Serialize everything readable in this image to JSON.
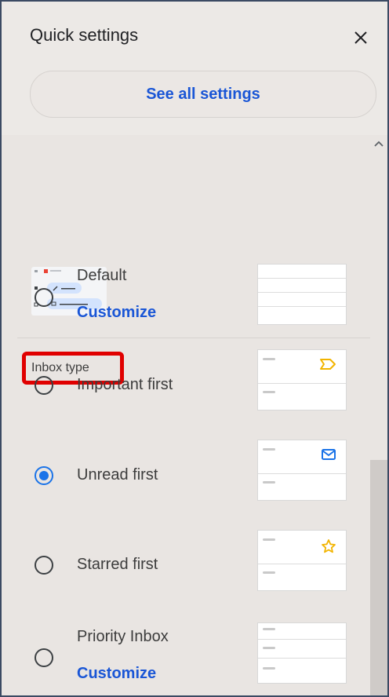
{
  "header": {
    "title": "Quick settings",
    "close_symbol": "✕",
    "see_all_label": "See all settings"
  },
  "inbox_type": {
    "label": "Inbox type",
    "options": [
      {
        "label": "Default",
        "customize": "Customize",
        "selected": false,
        "preview_icon": "none"
      },
      {
        "label": "Important first",
        "selected": false,
        "preview_icon": "important-marker-icon"
      },
      {
        "label": "Unread first",
        "selected": true,
        "preview_icon": "envelope-icon"
      },
      {
        "label": "Starred first",
        "selected": false,
        "preview_icon": "star-icon"
      },
      {
        "label": "Priority Inbox",
        "customize": "Customize",
        "selected": false,
        "preview_icon": "none"
      }
    ]
  },
  "colors": {
    "accent": "#1a73e8",
    "link": "#1a56d6",
    "highlight": "#e00000",
    "icon_yellow": "#f2b400",
    "icon_blue": "#1a73e8"
  }
}
